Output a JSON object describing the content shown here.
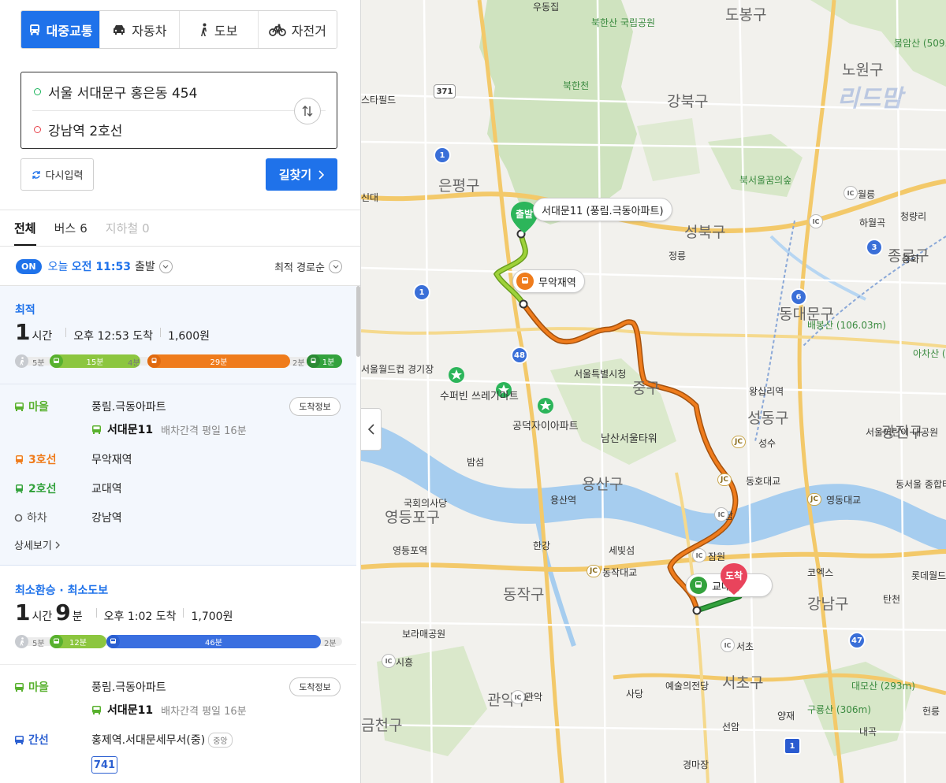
{
  "modes": [
    {
      "label": "대중교통",
      "icon": "bus-icon",
      "active": true
    },
    {
      "label": "자동차",
      "icon": "car-icon",
      "active": false
    },
    {
      "label": "도보",
      "icon": "walk-icon",
      "active": false
    },
    {
      "label": "자전거",
      "icon": "bicycle-icon",
      "active": false
    }
  ],
  "route": {
    "origin": "서울 서대문구 홍은동 454",
    "destination": "강남역 2호선"
  },
  "actions": {
    "reset": "다시입력",
    "search": "길찾기"
  },
  "tabs": [
    {
      "label": "전체",
      "count": ""
    },
    {
      "label": "버스",
      "count": "6"
    },
    {
      "label": "지하철",
      "count": "0"
    }
  ],
  "departure": {
    "on_badge": "ON",
    "day": "오늘",
    "time": "오전 11:53",
    "suffix": "출발",
    "sort": "최적 경로순"
  },
  "results": [
    {
      "label": "최적",
      "hours": "1",
      "hours_unit": "시간",
      "minutes": "",
      "minutes_unit": "",
      "arrival": "오후 12:53 도착",
      "fare": "1,600원",
      "bar": [
        {
          "type": "walk",
          "minutes": "5분"
        },
        {
          "type": "village-bus",
          "minutes": "15분"
        },
        {
          "type": "walk",
          "minutes": "4분"
        },
        {
          "type": "line3",
          "minutes": "29분"
        },
        {
          "type": "walk",
          "minutes": "2분"
        },
        {
          "type": "line2",
          "minutes": "1분"
        }
      ],
      "steps": [
        {
          "kind": "마을",
          "place": "풍림.극동아파트",
          "color": "#58b12e"
        },
        {
          "kind": "3호선",
          "place": "무악재역",
          "color": "#ef7c1c"
        },
        {
          "kind": "2호선",
          "place": "교대역",
          "color": "#33a23d"
        },
        {
          "kind": "하차",
          "place": "강남역",
          "color": "#555555"
        }
      ],
      "bus": {
        "name": "서대문11",
        "interval": "배차간격 평일 16분"
      },
      "arrival_info": "도착정보",
      "detail": "상세보기"
    },
    {
      "label": "최소환승 · 최소도보",
      "hours": "1",
      "hours_unit": "시간",
      "minutes": "9",
      "minutes_unit": "분",
      "arrival": "오후 1:02 도착",
      "fare": "1,700원",
      "bar": [
        {
          "type": "walk",
          "minutes": "5분"
        },
        {
          "type": "village-bus",
          "minutes": "12분"
        },
        {
          "type": "trunk-bus",
          "minutes": "46분"
        },
        {
          "type": "walk",
          "minutes": "2분"
        }
      ],
      "steps": [
        {
          "kind": "마을",
          "place": "풍림.극동아파트",
          "color": "#58b12e"
        },
        {
          "kind": "간선",
          "place": "홍제역.서대문세무서(중)",
          "color": "#2b5fd1",
          "tag": "중앙"
        }
      ],
      "bus": {
        "name": "서대문11",
        "interval": "배차간격 평일 16분"
      },
      "bus2": "741",
      "arrival_info": "도착정보"
    }
  ],
  "map": {
    "districts": [
      "도봉구",
      "노원구",
      "강북구",
      "은평구",
      "성북구",
      "동대문구",
      "종로구",
      "중구",
      "성동구",
      "용산구",
      "영등포구",
      "동작구",
      "강남구",
      "서초구",
      "관악구",
      "금천구",
      "광진구"
    ],
    "pois": [
      "우동집",
      "북한산 국립공원",
      "불암산 (509.6m)",
      "스타필드",
      "북한천",
      "북서울꿈의숲",
      "정릉",
      "하월곡",
      "월릉",
      "중화",
      "청량리",
      "배봉산 (106.03m)",
      "서울월드컵 경기장",
      "수퍼빈 쓰레기마트",
      "공덕자이아파트",
      "서울특별시청",
      "왕십리역",
      "남산서울타워",
      "서울어린이 대공원",
      "국회의사당",
      "밤섬",
      "용산역",
      "영등포역",
      "한강",
      "세빛섬",
      "동작대교",
      "동호대교",
      "영동대교",
      "성수",
      "한남",
      "잠원",
      "교대역",
      "코엑스",
      "롯데월드",
      "탄천",
      "보라매공원",
      "시흥",
      "서초",
      "예술의전당",
      "사당",
      "양재",
      "관악",
      "선암",
      "구룡산 (306m)",
      "대모산 (293m)",
      "경마장",
      "내곡",
      "헌릉",
      "동서울 종합터미널",
      "아차산 (295.7m)",
      "신대"
    ],
    "route_labels": {
      "start_pin": "출발",
      "start_stop": "서대문11 (풍림.극동아파트)",
      "transfer": "무악재역",
      "end_pin": "도착",
      "end_stop": "교대역"
    },
    "road_numbers": [
      "371",
      "1",
      "1",
      "48",
      "3",
      "6",
      "47",
      "1"
    ],
    "junctions": [
      "JC",
      "JC",
      "JC",
      "JC",
      "IC",
      "IC",
      "IC",
      "IC",
      "IC",
      "IC",
      "IC"
    ],
    "watermark": "리드맘"
  }
}
